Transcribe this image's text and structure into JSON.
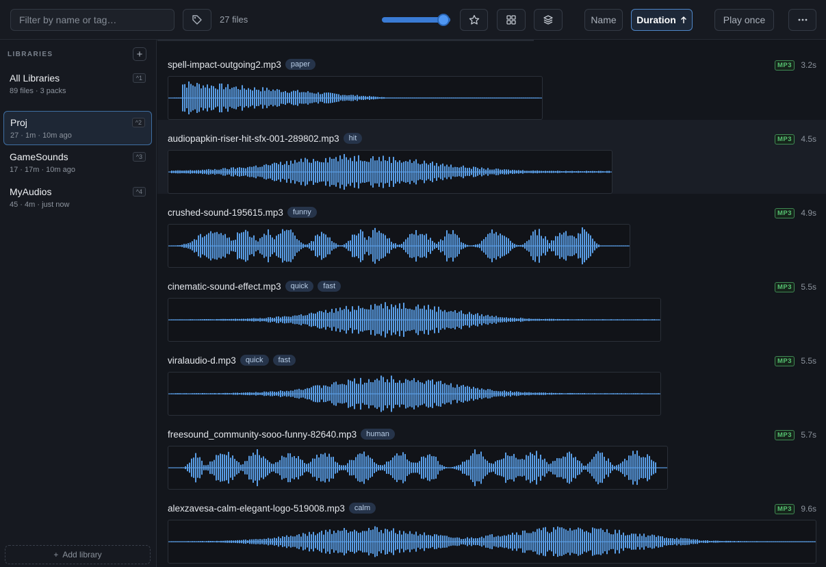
{
  "toolbar": {
    "search_placeholder": "Filter by name or tag…",
    "tag_icon": "tag-icon",
    "file_count": "27 files",
    "volume": 0.9,
    "sort_name_label": "Name",
    "sort_duration_label": "Duration",
    "sort_direction_icon": "arrow-up-icon",
    "play_mode_label": "Play once",
    "more_icon": "ellipsis-icon"
  },
  "sidebar": {
    "header": "LIBRARIES",
    "add_label": "+",
    "add_library_label": "Add library",
    "libraries": [
      {
        "name": "All Libraries",
        "meta": "89 files · 3 packs",
        "shortcut": "^1"
      },
      {
        "name": "Proj",
        "meta": "27 · 1m · 10m ago",
        "shortcut": "^2"
      },
      {
        "name": "GameSounds",
        "meta": "17 · 17m · 10m ago",
        "shortcut": "^3"
      },
      {
        "name": "MyAudios",
        "meta": "45 · 4m · just now",
        "shortcut": "^4"
      }
    ]
  },
  "files": [
    {
      "name": "spell-impact-outgoing2.mp3",
      "tags": [
        "paper"
      ],
      "format": "MP3",
      "duration": "3.2s"
    },
    {
      "name": "audiopapkin-riser-hit-sfx-001-289802.mp3",
      "tags": [
        "hit"
      ],
      "format": "MP3",
      "duration": "4.5s"
    },
    {
      "name": "crushed-sound-195615.mp3",
      "tags": [
        "funny"
      ],
      "format": "MP3",
      "duration": "4.9s"
    },
    {
      "name": "cinematic-sound-effect.mp3",
      "tags": [
        "quick",
        "fast"
      ],
      "format": "MP3",
      "duration": "5.5s"
    },
    {
      "name": "viralaudio-d.mp3",
      "tags": [
        "quick",
        "fast"
      ],
      "format": "MP3",
      "duration": "5.5s"
    },
    {
      "name": "freesound_community-sooo-funny-82640.mp3",
      "tags": [
        "human"
      ],
      "format": "MP3",
      "duration": "5.7s"
    },
    {
      "name": "alexzavesa-calm-elegant-logo-519008.mp3",
      "tags": [
        "calm"
      ],
      "format": "MP3",
      "duration": "9.6s"
    }
  ],
  "colors": {
    "accent": "#3a7bd5",
    "waveform": "#5a9ee6",
    "format_badge": "#56c271"
  }
}
